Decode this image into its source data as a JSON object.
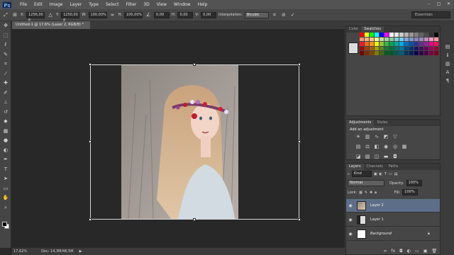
{
  "app": {
    "logo": "Ps"
  },
  "menu": [
    "File",
    "Edit",
    "Image",
    "Layer",
    "Type",
    "Select",
    "Filter",
    "3D",
    "View",
    "Window",
    "Help"
  ],
  "window_controls": [
    "–",
    "□",
    "✕"
  ],
  "options": {
    "x_label": "X:",
    "x_value": "1256,00 p",
    "y_label": "Y:",
    "y_value": "1250,00 p",
    "w_label": "W:",
    "w_value": "100,00%",
    "h_label": "H:",
    "h_value": "100,00%",
    "angle_value": "0,00",
    "hskew_label": "H:",
    "hskew_value": "0,00",
    "vskew_label": "V:",
    "vskew_value": "0,00",
    "interp_label": "Interpolation:",
    "interp_value": "Bicubic",
    "workspace": "Essentials"
  },
  "document": {
    "tab": "Untitled-1 @ 17,6% (Layer 2, RGB/8) *"
  },
  "status": {
    "zoom": "17,62%",
    "doc": "Doc: 14,3M/46,5M"
  },
  "panels": {
    "color_tabs": [
      "Color",
      "Swatches"
    ],
    "adjust_tabs": [
      "Adjustments",
      "Styles"
    ],
    "adjust_title": "Add an adjustment",
    "layers_tabs": [
      "Layers",
      "Channels",
      "Paths"
    ],
    "kind": "Kind",
    "blend": "Normal",
    "opacity_label": "Opacity:",
    "opacity_value": "100%",
    "lock_label": "Lock:",
    "fill_label": "Fill:",
    "fill_value": "100%"
  },
  "layers": [
    {
      "name": "Layer 2",
      "selected": true
    },
    {
      "name": "Layer 1",
      "selected": false
    },
    {
      "name": "Background",
      "selected": false,
      "italic": true,
      "locked": true
    }
  ],
  "swatch_colors": [
    "#ff0000",
    "#ffff00",
    "#00ff00",
    "#00ffff",
    "#0000ff",
    "#ff00ff",
    "#ffffff",
    "#e6e6e6",
    "#cccccc",
    "#b3b3b3",
    "#999999",
    "#808080",
    "#666666",
    "#4d4d4d",
    "#333333",
    "#000000",
    "#f7977a",
    "#f9ad81",
    "#fdc68a",
    "#fff79a",
    "#c4df9b",
    "#a3d39c",
    "#82ca9d",
    "#7bcdc8",
    "#6ecff6",
    "#7ea7d8",
    "#8493ca",
    "#8882be",
    "#a187be",
    "#bc8dbf",
    "#f49ac2",
    "#f6989d",
    "#ed1c24",
    "#f26522",
    "#f7941d",
    "#fff200",
    "#8dc63f",
    "#39b54a",
    "#00a651",
    "#00a99d",
    "#00aeef",
    "#0072bc",
    "#0054a6",
    "#2e3192",
    "#662d91",
    "#92278f",
    "#ec008c",
    "#ed145b",
    "#9e0b0f",
    "#a0410d",
    "#a36209",
    "#aba000",
    "#598527",
    "#1a7b30",
    "#007236",
    "#00746b",
    "#0076a3",
    "#004b80",
    "#003471",
    "#1b1464",
    "#440e62",
    "#630460",
    "#9e005d",
    "#9e0039",
    "#790000",
    "#7b2e00",
    "#7d4900",
    "#827b00",
    "#406618",
    "#005e20",
    "#005826",
    "#005952",
    "#005b7f",
    "#003663",
    "#002157",
    "#0d004c",
    "#32004b",
    "#4b0049",
    "#7b0046",
    "#7a0026"
  ],
  "icons": {
    "tools": [
      "move-icon",
      "marquee-icon",
      "lasso-icon",
      "quick-select-icon",
      "crop-icon",
      "eyedropper-icon",
      "healing-icon",
      "brush-icon",
      "clone-stamp-icon",
      "history-brush-icon",
      "eraser-icon",
      "gradient-icon",
      "blur-icon",
      "dodge-icon",
      "pen-icon",
      "type-icon",
      "path-select-icon",
      "shape-icon",
      "hand-icon",
      "zoom-icon"
    ]
  }
}
